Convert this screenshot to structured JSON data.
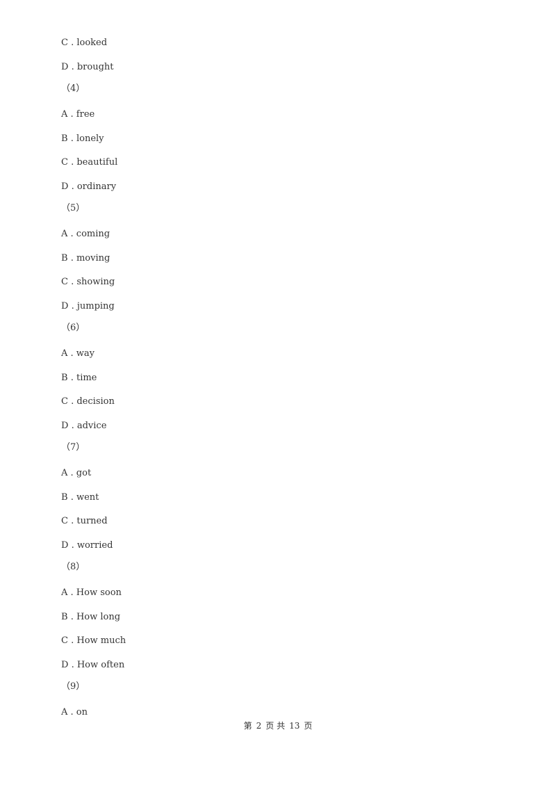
{
  "items": [
    {
      "type": "option",
      "letter": "C",
      "text": "looked"
    },
    {
      "type": "option",
      "letter": "D",
      "text": "brought"
    },
    {
      "type": "question",
      "text": "（4）"
    },
    {
      "type": "option",
      "letter": "A",
      "text": "free"
    },
    {
      "type": "option",
      "letter": "B",
      "text": "lonely"
    },
    {
      "type": "option",
      "letter": "C",
      "text": "beautiful"
    },
    {
      "type": "option",
      "letter": "D",
      "text": "ordinary"
    },
    {
      "type": "question",
      "text": "（5）"
    },
    {
      "type": "option",
      "letter": "A",
      "text": "coming"
    },
    {
      "type": "option",
      "letter": "B",
      "text": "moving"
    },
    {
      "type": "option",
      "letter": "C",
      "text": "showing"
    },
    {
      "type": "option",
      "letter": "D",
      "text": "jumping"
    },
    {
      "type": "question",
      "text": "（6）"
    },
    {
      "type": "option",
      "letter": "A",
      "text": "way"
    },
    {
      "type": "option",
      "letter": "B",
      "text": "time"
    },
    {
      "type": "option",
      "letter": "C",
      "text": "decision"
    },
    {
      "type": "option",
      "letter": "D",
      "text": "advice"
    },
    {
      "type": "question",
      "text": "（7）"
    },
    {
      "type": "option",
      "letter": "A",
      "text": "got"
    },
    {
      "type": "option",
      "letter": "B",
      "text": "went"
    },
    {
      "type": "option",
      "letter": "C",
      "text": "turned"
    },
    {
      "type": "option",
      "letter": "D",
      "text": "worried"
    },
    {
      "type": "question",
      "text": "（8）"
    },
    {
      "type": "option",
      "letter": "A",
      "text": "How soon"
    },
    {
      "type": "option",
      "letter": "B",
      "text": "How long"
    },
    {
      "type": "option",
      "letter": "C",
      "text": "How much"
    },
    {
      "type": "option",
      "letter": "D",
      "text": "How often"
    },
    {
      "type": "question",
      "text": "（9）"
    },
    {
      "type": "option",
      "letter": "A",
      "text": "on"
    }
  ],
  "footer": {
    "prefix": "第",
    "page": "2",
    "mid": "页 共",
    "total": "13",
    "suffix": "页"
  }
}
